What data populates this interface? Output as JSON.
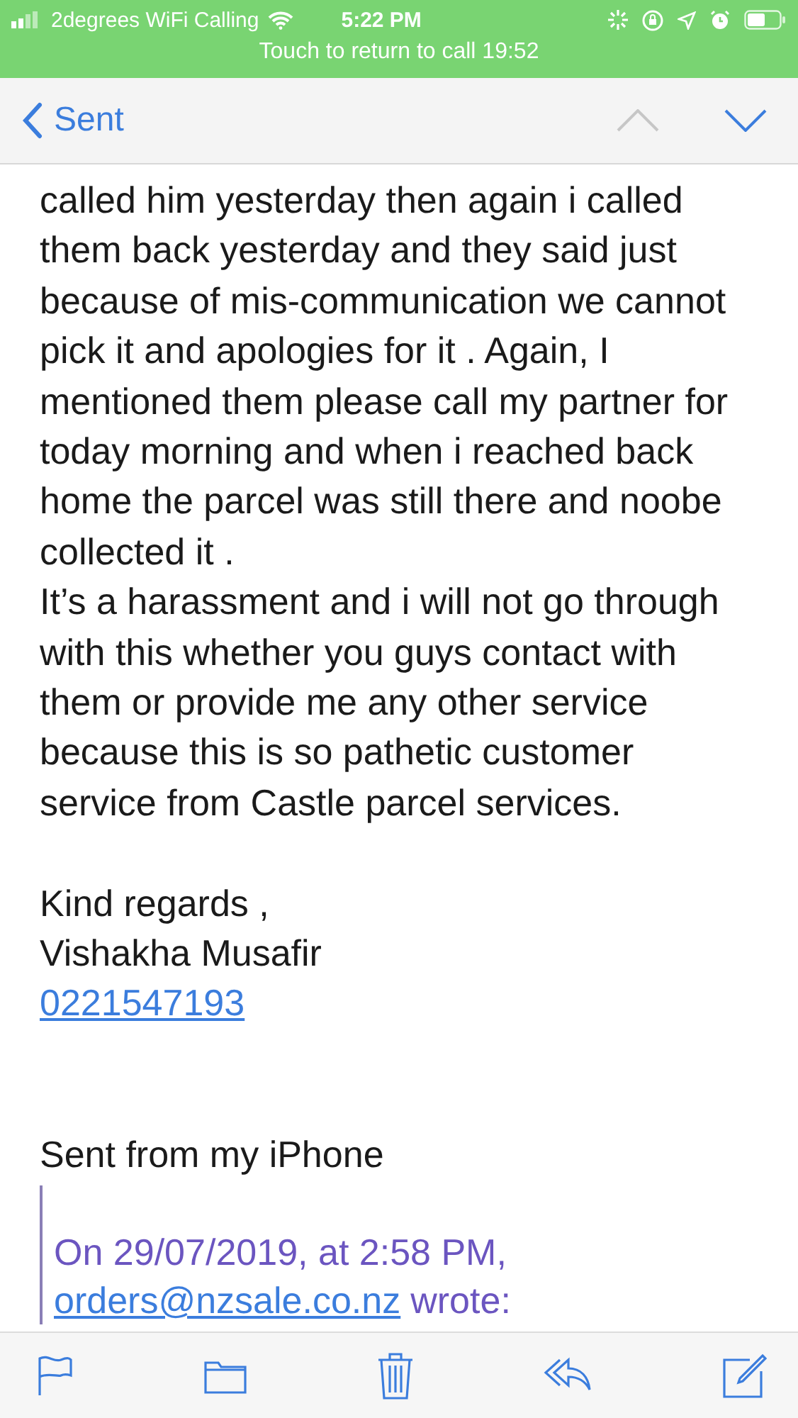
{
  "status_bar": {
    "carrier": "2degrees WiFi Calling",
    "time": "5:22 PM",
    "call_banner": "Touch to return to call 19:52"
  },
  "nav": {
    "back_label": "Sent",
    "previous_disabled": true,
    "next_disabled": false
  },
  "message": {
    "paragraphs": [
      {
        "lines": [
          "called him yesterday then again i called",
          "them back yesterday and they said just",
          "because of mis-communication we cannot",
          "pick it and apologies for it . Again, I",
          "mentioned them please call my partner for",
          "today morning and when i reached back",
          "home the parcel was still there and noobe",
          "collected it .",
          "It’s a harassment and i will not go through",
          "with this whether you guys contact with",
          "them or provide me any other service",
          "because this is so pathetic customer",
          "service from Castle parcel services."
        ]
      },
      {
        "lines": [
          "Kind regards ,",
          "Vishakha Musafir"
        ]
      }
    ],
    "phone": "0221547193",
    "signature": "Sent from my iPhone"
  },
  "quote": {
    "header": "On 29/07/2019, at 2:58 PM,",
    "email": "orders@nzsale.co.nz",
    "wrote": "wrote:"
  }
}
